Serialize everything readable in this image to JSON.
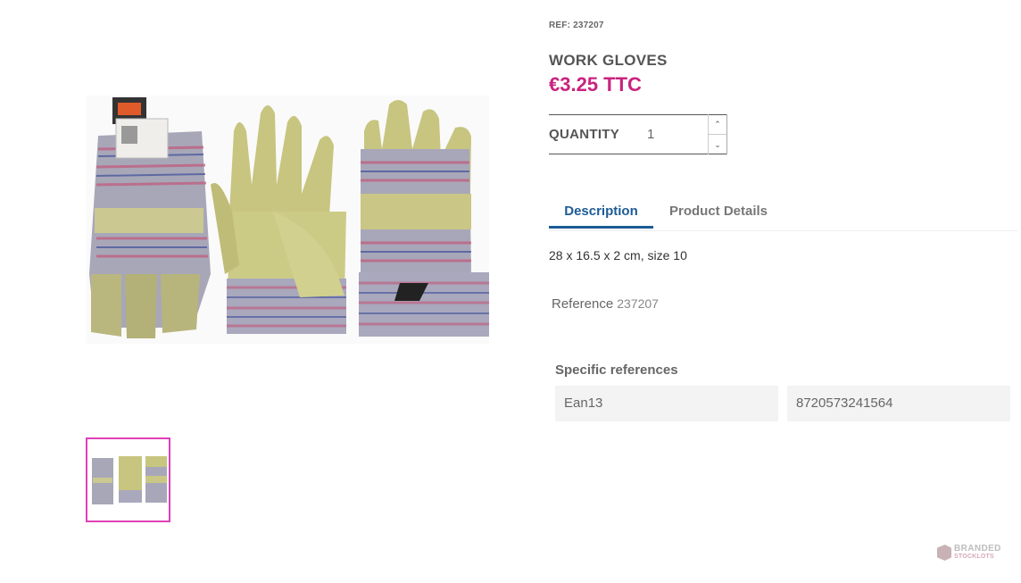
{
  "product": {
    "ref_label": "REF: 237207",
    "title": "WORK GLOVES",
    "price": "€3.25 TTC"
  },
  "quantity": {
    "label": "QUANTITY",
    "value": "1",
    "up_icon": "chevron-up-icon",
    "down_icon": "chevron-down-icon"
  },
  "tabs": [
    {
      "label": "Description",
      "active": true
    },
    {
      "label": "Product Details",
      "active": false
    }
  ],
  "description": {
    "text": "28 x 16.5 x 2 cm, size 10"
  },
  "details": {
    "reference_label": "Reference",
    "reference_value": "237207",
    "specific_references_title": "Specific references",
    "spec_name": "Ean13",
    "spec_value": "8720573241564"
  },
  "brand": {
    "line1": "BRANDED",
    "line2": "STOCKLOTS"
  },
  "colors": {
    "accent_price": "#c9237f",
    "tab_active": "#1d5c96",
    "thumb_border": "#e040b6"
  }
}
